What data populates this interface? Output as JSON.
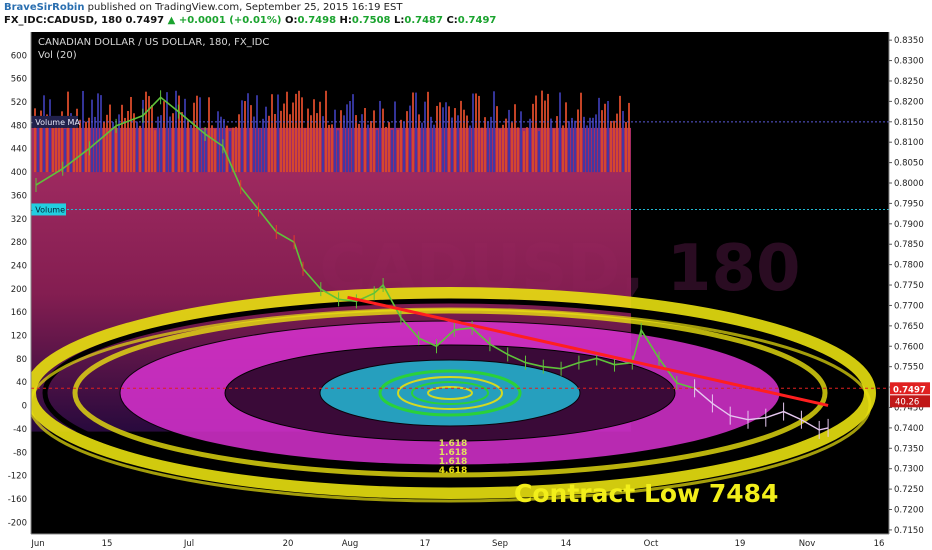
{
  "header": {
    "author": "BraveSirRobin",
    "published": "published on TradingView.com, September 25, 2015 16:19 EST",
    "symbol": "FX_IDC:CADUSD, 180",
    "last": "0.7497",
    "change": "+0.0001 (+0.01%)",
    "o_label": "O:",
    "o": "0.7498",
    "h_label": "H:",
    "h": "0.7508",
    "l_label": "L:",
    "l": "0.7487",
    "c_label": "C:",
    "c": "0.7497"
  },
  "chart_data": {
    "type": "line",
    "title": "CANADIAN DOLLAR / US DOLLAR, 180, FX_IDC",
    "subtitle": "Vol (20)",
    "watermark": "CADUSD, 180",
    "annotation": "Contract Low 7484",
    "price_axis": {
      "ylim": [
        0.714,
        0.837
      ],
      "ticks": [
        "0.8350",
        "0.8300",
        "0.8250",
        "0.8200",
        "0.8150",
        "0.8100",
        "0.8050",
        "0.8000",
        "0.7950",
        "0.7900",
        "0.7850",
        "0.7800",
        "0.7750",
        "0.7700",
        "0.7650",
        "0.7600",
        "0.7550",
        "0.7500",
        "0.7450",
        "0.7400",
        "0.7350",
        "0.7300",
        "0.7250",
        "0.7200",
        "0.7150"
      ],
      "last_price_label": "0.7497",
      "last_volume_label": "40.26"
    },
    "volume_axis": {
      "ylim": [
        -220,
        640
      ],
      "ticks": [
        "600",
        "560",
        "520",
        "480",
        "440",
        "400",
        "360",
        "320",
        "280",
        "240",
        "200",
        "160",
        "120",
        "80",
        "40",
        "0",
        "-40",
        "-80",
        "-120",
        "-160",
        "-200"
      ],
      "volume_ma_label": "486 - Volume MA",
      "volume_label": "336 - Volume",
      "volume_ma_value": 486,
      "volume_value": 336
    },
    "x_axis": {
      "labels": [
        "Jun",
        "15",
        "Jul",
        "20",
        "Aug",
        "17",
        "Sep",
        "14",
        "Oct",
        "19",
        "Nov",
        "16"
      ]
    },
    "price_path": [
      {
        "t": 0,
        "p": 0.7995
      },
      {
        "t": 3,
        "p": 0.8035
      },
      {
        "t": 6,
        "p": 0.8085
      },
      {
        "t": 9,
        "p": 0.814
      },
      {
        "t": 12,
        "p": 0.8165
      },
      {
        "t": 14,
        "p": 0.821
      },
      {
        "t": 16,
        "p": 0.8175
      },
      {
        "t": 19,
        "p": 0.812
      },
      {
        "t": 21,
        "p": 0.809
      },
      {
        "t": 23,
        "p": 0.799
      },
      {
        "t": 25,
        "p": 0.7935
      },
      {
        "t": 27,
        "p": 0.788
      },
      {
        "t": 29,
        "p": 0.7855
      },
      {
        "t": 30,
        "p": 0.779
      },
      {
        "t": 32,
        "p": 0.774
      },
      {
        "t": 34,
        "p": 0.7715
      },
      {
        "t": 36,
        "p": 0.771
      },
      {
        "t": 38,
        "p": 0.773
      },
      {
        "t": 39,
        "p": 0.775
      },
      {
        "t": 41,
        "p": 0.767
      },
      {
        "t": 43,
        "p": 0.762
      },
      {
        "t": 45,
        "p": 0.76
      },
      {
        "t": 47,
        "p": 0.764
      },
      {
        "t": 49,
        "p": 0.7645
      },
      {
        "t": 51,
        "p": 0.7605
      },
      {
        "t": 53,
        "p": 0.758
      },
      {
        "t": 55,
        "p": 0.756
      },
      {
        "t": 57,
        "p": 0.755
      },
      {
        "t": 59,
        "p": 0.7545
      },
      {
        "t": 61,
        "p": 0.756
      },
      {
        "t": 63,
        "p": 0.757
      },
      {
        "t": 65,
        "p": 0.7555
      },
      {
        "t": 67,
        "p": 0.756
      },
      {
        "t": 68,
        "p": 0.764
      },
      {
        "t": 70,
        "p": 0.757
      },
      {
        "t": 72,
        "p": 0.751
      },
      {
        "t": 74,
        "p": 0.7497
      }
    ],
    "projection_path": [
      {
        "t": 74,
        "p": 0.7497
      },
      {
        "t": 76,
        "p": 0.746
      },
      {
        "t": 78,
        "p": 0.743
      },
      {
        "t": 80,
        "p": 0.742
      },
      {
        "t": 82,
        "p": 0.7425
      },
      {
        "t": 84,
        "p": 0.744
      },
      {
        "t": 86,
        "p": 0.742
      },
      {
        "t": 88,
        "p": 0.7395
      },
      {
        "t": 89,
        "p": 0.74
      }
    ],
    "trendline": [
      {
        "t": 35,
        "p": 0.772
      },
      {
        "t": 89,
        "p": 0.7455
      }
    ],
    "fib_labels": [
      "1.618",
      "1.618",
      "1.618",
      "4.618"
    ],
    "colors": {
      "background": "#000000",
      "volume_fill": "#a0245a",
      "volume_up": "#d94a2a",
      "volume_down": "#3a3aa8",
      "price_line": "#5fc23a",
      "trendline": "#ff1f1f",
      "yellow_ring": "#e8e010",
      "magenta_ring": "#d932d0",
      "cyan_ring": "#22c5e0",
      "green_ring": "#2bd62b",
      "projection": "#e6c8f0",
      "annotation": "#f2ee1a",
      "last_price_tag": "#e02020",
      "volume_tag": "#22cfe0"
    }
  }
}
